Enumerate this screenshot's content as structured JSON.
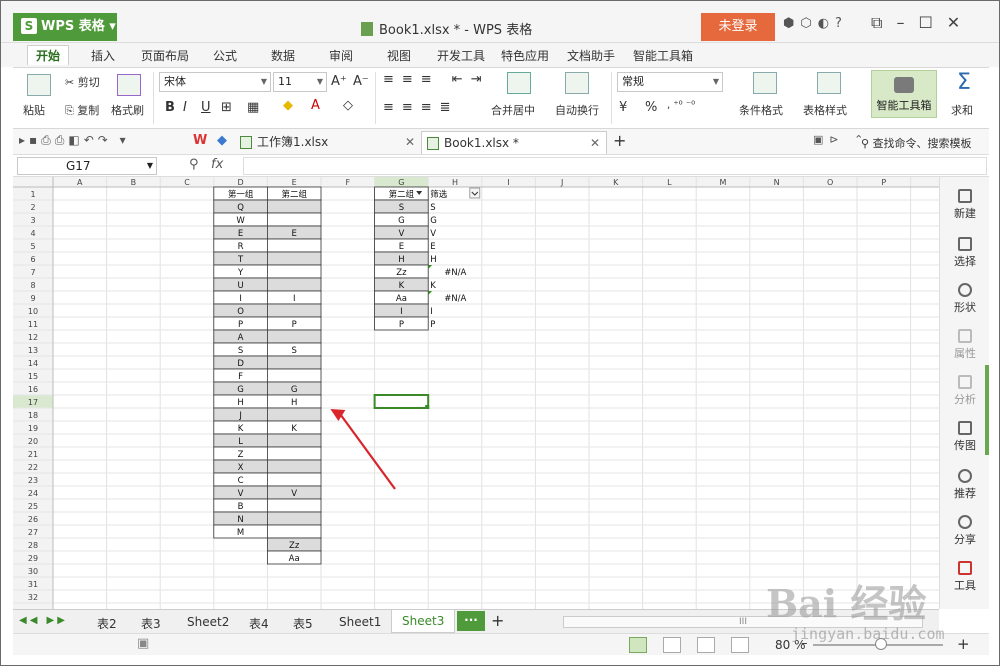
{
  "app": {
    "logo_text": "WPS 表格",
    "window_title": "Book1.xlsx * - WPS 表格",
    "login_label": "未登录"
  },
  "menu_tabs": [
    "开始",
    "插入",
    "页面布局",
    "公式",
    "数据",
    "审阅",
    "视图",
    "开发工具",
    "特色应用",
    "文档助手",
    "智能工具箱"
  ],
  "ribbon": {
    "paste": "粘贴",
    "cut": "剪切",
    "copy": "复制",
    "format_painter": "格式刷",
    "font_name": "宋体",
    "font_size": "11",
    "merge_center": "合并居中",
    "wrap_text": "自动换行",
    "number_format": "常规",
    "percent": "%",
    "cond_format": "条件格式",
    "table_style": "表格样式",
    "smart_toolbox": "智能工具箱",
    "sum": "求和"
  },
  "quick_access": {
    "doc_tab1": "工作簿1.xlsx",
    "doc_tab2": "Book1.xlsx *",
    "search_placeholder": "查找命令、搜索模板"
  },
  "formula_bar": {
    "name_box": "G17",
    "fx": "fx",
    "formula": ""
  },
  "grid": {
    "columns": [
      "A",
      "B",
      "C",
      "D",
      "E",
      "F",
      "G",
      "H",
      "I",
      "J",
      "K",
      "L",
      "M",
      "N",
      "O",
      "P"
    ],
    "row_count": 32,
    "selected_cell": "G17",
    "col_D": [
      "第一组",
      "Q",
      "W",
      "E",
      "R",
      "T",
      "Y",
      "U",
      "I",
      "O",
      "P",
      "A",
      "S",
      "D",
      "F",
      "G",
      "H",
      "J",
      "K",
      "L",
      "Z",
      "X",
      "C",
      "V",
      "B",
      "N",
      "M"
    ],
    "col_E": [
      "第二组",
      "",
      "",
      "E",
      "",
      "",
      "",
      "",
      "I",
      "",
      "P",
      "",
      "S",
      "",
      "",
      "G",
      "H",
      "",
      "K",
      "",
      "",
      "",
      "",
      "V",
      "",
      "",
      "",
      "Zz",
      "Aa"
    ],
    "col_G": [
      "第二组",
      "S",
      "G",
      "V",
      "E",
      "H",
      "Zz",
      "K",
      "Aa",
      "I",
      "P"
    ],
    "col_H": [
      "筛选",
      "S",
      "G",
      "V",
      "E",
      "H",
      "#N/A",
      "K",
      "#N/A",
      "I",
      "P"
    ]
  },
  "right_panel": [
    "新建",
    "选择",
    "形状",
    "属性",
    "分析",
    "传图",
    "推荐",
    "分享",
    "工具"
  ],
  "sheet_tabs": [
    "表2",
    "表3",
    "Sheet2",
    "表4",
    "表5",
    "Sheet1",
    "Sheet3"
  ],
  "active_sheet": "Sheet3",
  "more_tabs": "···",
  "add_sheet": "+",
  "status": {
    "zoom": "80 %"
  },
  "watermark": {
    "text": "Bai 经验",
    "url": "jingyan.baidu.com"
  },
  "colors": {
    "accent": "#4f9a3a",
    "login": "#e5693d",
    "arrow": "#d8262c"
  }
}
